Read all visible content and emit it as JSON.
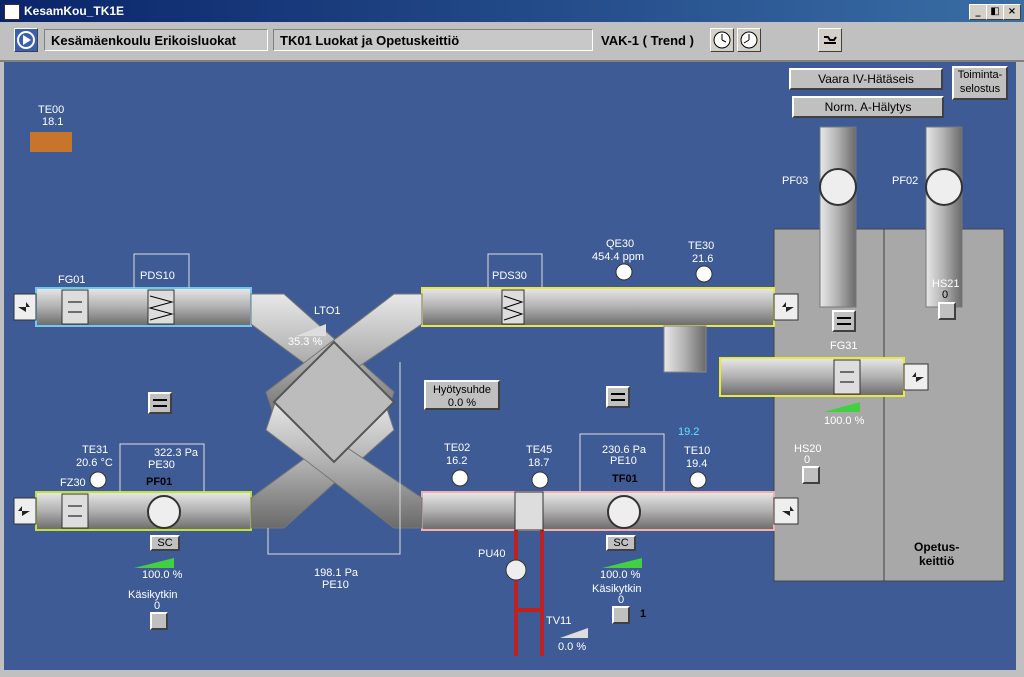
{
  "window": {
    "title": "KesamKou_TK1E",
    "min": "_",
    "restore": "◧",
    "close": "×"
  },
  "toolbar": {
    "site": "Kesämäenkoulu Erikoisluokat",
    "area": "TK01 Luokat ja Opetuskeittiö",
    "unit": "VAK-1 ( Trend )"
  },
  "buttons": {
    "emergency": "Vaara  IV-Hätäseis",
    "normal": "Norm.  A-Hälytys",
    "description": "Toiminta-\nselostus"
  },
  "sensors": {
    "te00": {
      "tag": "TE00",
      "value": "18.1"
    },
    "te31": {
      "tag": "TE31",
      "value": "20.6 °C"
    },
    "te02": {
      "tag": "TE02",
      "value": "16.2"
    },
    "te45": {
      "tag": "TE45",
      "value": "18.7"
    },
    "te10": {
      "tag": "TE10",
      "value": "19.4"
    },
    "te10_setpoint": "19.2",
    "te30": {
      "tag": "TE30",
      "value": "21.6"
    },
    "qe30": {
      "tag": "QE30",
      "value": "454.4 ppm"
    }
  },
  "pressure": {
    "pds10": "PDS10",
    "pds30": "PDS30",
    "pe30": {
      "value": "322.3 Pa",
      "tag": "PE30"
    },
    "pe10a": {
      "value": "230.6 Pa",
      "tag": "PE10"
    },
    "pe10b": {
      "value": "198.1 Pa",
      "tag": "PE10"
    }
  },
  "devices": {
    "fg01": "FG01",
    "fz30": "FZ30",
    "pf01": "PF01",
    "tf01": "TF01",
    "lto1": {
      "tag": "LTO1",
      "value": "35.3 %"
    },
    "fg31": {
      "tag": "FG31",
      "value": "100.0 %"
    },
    "pf03": "PF03",
    "pf02": "PF02",
    "hs21": {
      "tag": "HS21",
      "value": "0"
    },
    "hs20": {
      "tag": "HS20",
      "value": "0"
    },
    "pu40": "PU40",
    "tv11": {
      "tag": "TV11",
      "value": "0.0 %"
    },
    "pf01_speed": "100.0 %",
    "tf01_speed": "100.0 %",
    "sc": "SC",
    "kasi1": {
      "label": "Käsikytkin",
      "value": "0"
    },
    "kasi2": {
      "label": "Käsikytkin",
      "value": "0"
    },
    "pump_state": "1"
  },
  "efficiency": {
    "label": "Hyötysuhde",
    "value": "0.0 %"
  },
  "room": {
    "name": "Opetus-\nkeittiö"
  }
}
